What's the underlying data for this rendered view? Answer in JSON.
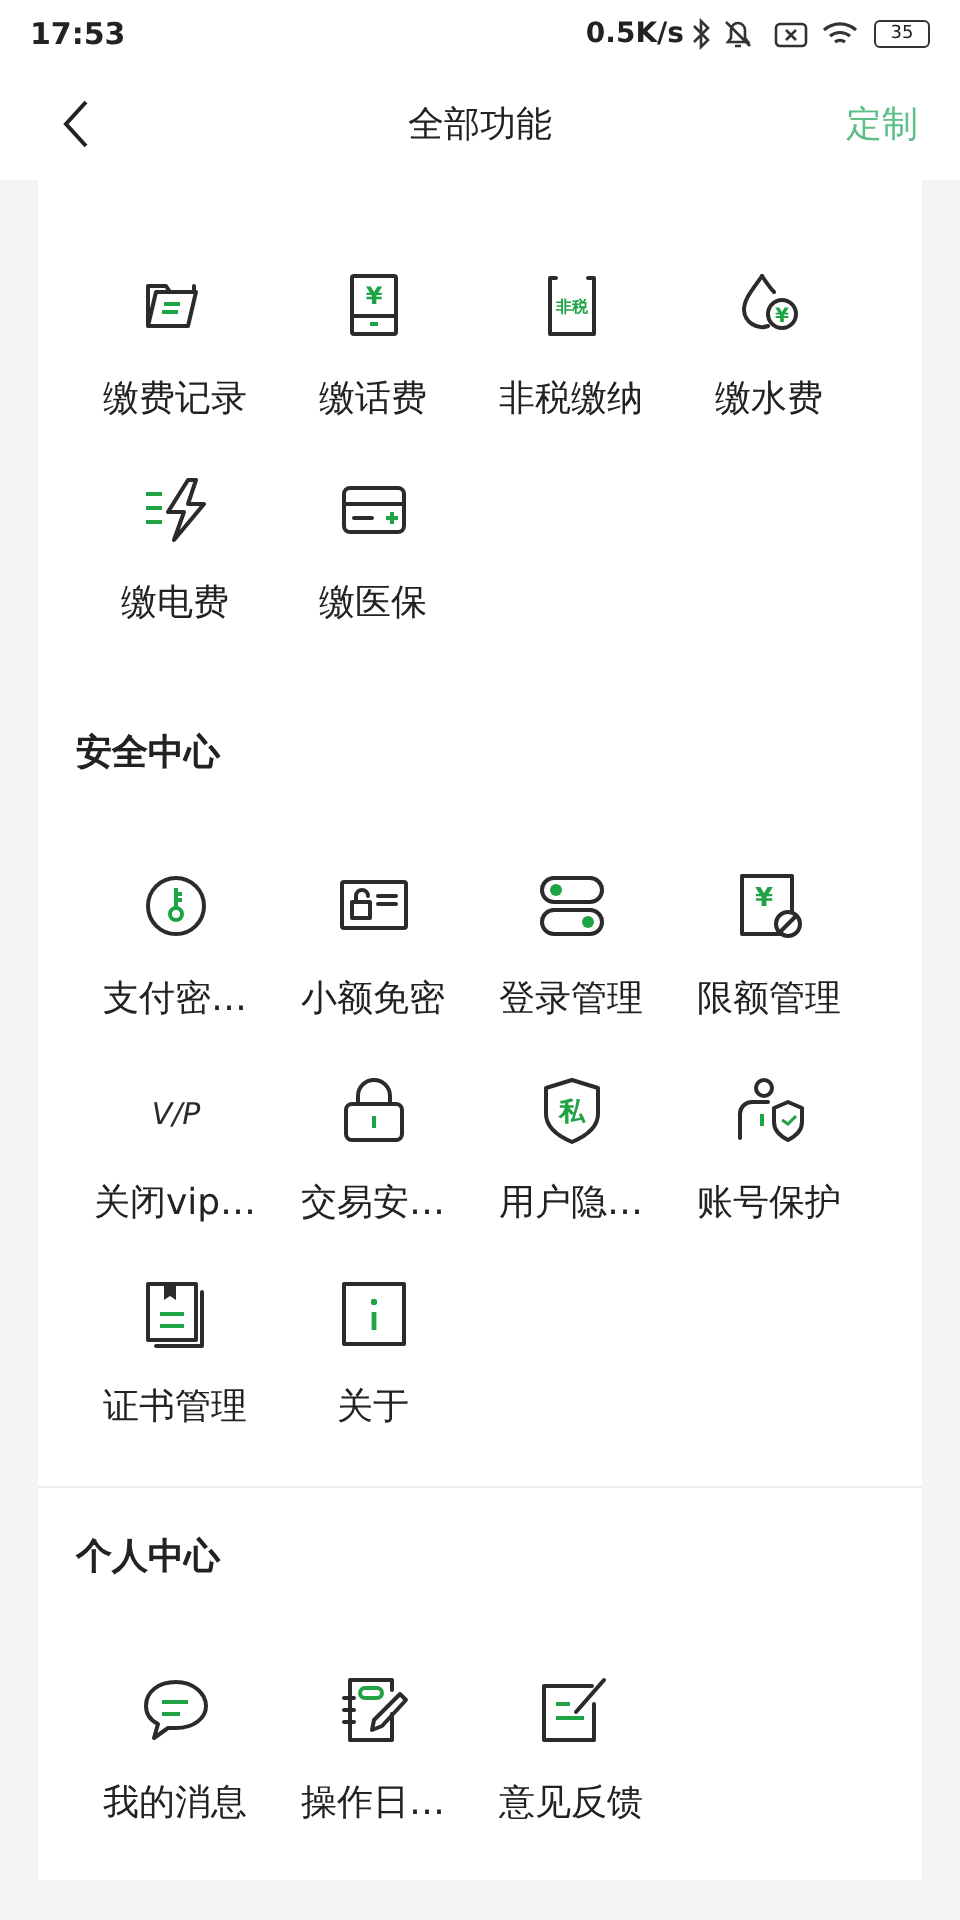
{
  "status_bar": {
    "time": "17:53",
    "network_speed": "0.5K/s",
    "battery": "35"
  },
  "header": {
    "title": "全部功能",
    "action": "定制"
  },
  "sections": [
    {
      "items": [
        {
          "label": "缴费记录",
          "kind": "folder"
        },
        {
          "label": "缴话费",
          "kind": "phone-bill",
          "icon_text": "¥"
        },
        {
          "label": "非税缴纳",
          "kind": "tax",
          "icon_text": "非税"
        },
        {
          "label": "缴水费",
          "kind": "water",
          "icon_text": "¥"
        },
        {
          "label": "缴电费",
          "kind": "power"
        },
        {
          "label": "缴医保",
          "kind": "card"
        }
      ]
    },
    {
      "title": "安全中心",
      "items": [
        {
          "label": "支付密…",
          "kind": "key"
        },
        {
          "label": "小额免密",
          "kind": "id-lock"
        },
        {
          "label": "登录管理",
          "kind": "toggles"
        },
        {
          "label": "限额管理",
          "kind": "limit",
          "icon_text": "¥"
        },
        {
          "label": "关闭vip…",
          "kind": "vip",
          "icon_text": "V/P"
        },
        {
          "label": "交易安…",
          "kind": "lock"
        },
        {
          "label": "用户隐…",
          "kind": "shield",
          "icon_text": "私"
        },
        {
          "label": "账号保护",
          "kind": "person-shield"
        },
        {
          "label": "证书管理",
          "kind": "book"
        },
        {
          "label": "关于",
          "kind": "info"
        }
      ]
    },
    {
      "title": "个人中心",
      "items": [
        {
          "label": "我的消息",
          "kind": "chat"
        },
        {
          "label": "操作日…",
          "kind": "notebook"
        },
        {
          "label": "意见反馈",
          "kind": "feedback"
        }
      ]
    }
  ]
}
